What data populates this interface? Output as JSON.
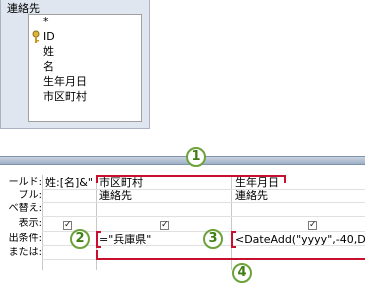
{
  "table": {
    "title": "連絡先",
    "fields": [
      "*",
      "ID",
      "姓",
      "名",
      "生年月日",
      "市区町村"
    ]
  },
  "grid": {
    "row_labels": {
      "field": "ールド:",
      "table": "ブル:",
      "sort": "べ替え:",
      "show": "表示:",
      "criteria": "出条件:",
      "or": "または:"
    },
    "columns": [
      {
        "field": "姓:[名]&\"",
        "table": "",
        "show": true,
        "criteria": ""
      },
      {
        "field": "市区町村",
        "table": "連絡先",
        "show": true,
        "criteria": "=\"兵庫県\""
      },
      {
        "field": "生年月日",
        "table": "連絡先",
        "show": true,
        "criteria": "<DateAdd(\"yyyy\",-40,Dat"
      }
    ]
  },
  "callouts": [
    "1",
    "2",
    "3",
    "4"
  ],
  "colors": {
    "highlight": "#c8102e",
    "callout": "#6ca23a"
  }
}
